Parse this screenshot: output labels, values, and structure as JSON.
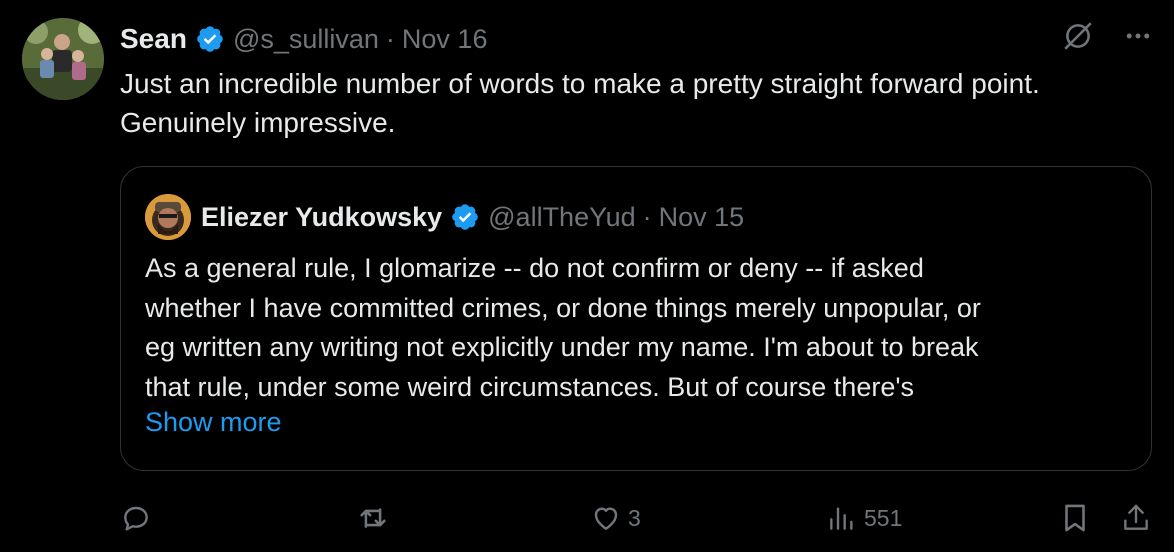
{
  "post": {
    "author_name": "Sean",
    "handle": "@s_sullivan",
    "separator": "·",
    "date": "Nov 16",
    "text": "Just an incredible number of words to make a pretty straight forward point. Genuinely impressive."
  },
  "quoted_post": {
    "author_name": "Eliezer Yudkowsky",
    "handle": "@allTheYud",
    "separator": "·",
    "date": "Nov 15",
    "text": "As a general rule, I glomarize -- do not confirm or deny -- if asked\nwhether I have committed crimes, or done things merely unpopular, or\neg written any writing not explicitly under my name.  I'm about to break\nthat rule, under some weird circumstances.  But of course there's",
    "show_more_label": "Show more"
  },
  "actions": {
    "reply": {
      "icon": "reply-icon",
      "count": ""
    },
    "repost": {
      "icon": "repost-icon",
      "count": ""
    },
    "like": {
      "icon": "heart-icon",
      "count": "3"
    },
    "views": {
      "icon": "views-icon",
      "count": "551"
    },
    "bookmark": {
      "icon": "bookmark-icon"
    },
    "share": {
      "icon": "share-icon"
    }
  },
  "top_right_icons": [
    "grok-icon",
    "more-icon"
  ],
  "colors": {
    "background": "#000000",
    "text": "#e7e9ea",
    "secondary": "#71767b",
    "accent": "#1d9bf0",
    "border": "#2f3336"
  }
}
